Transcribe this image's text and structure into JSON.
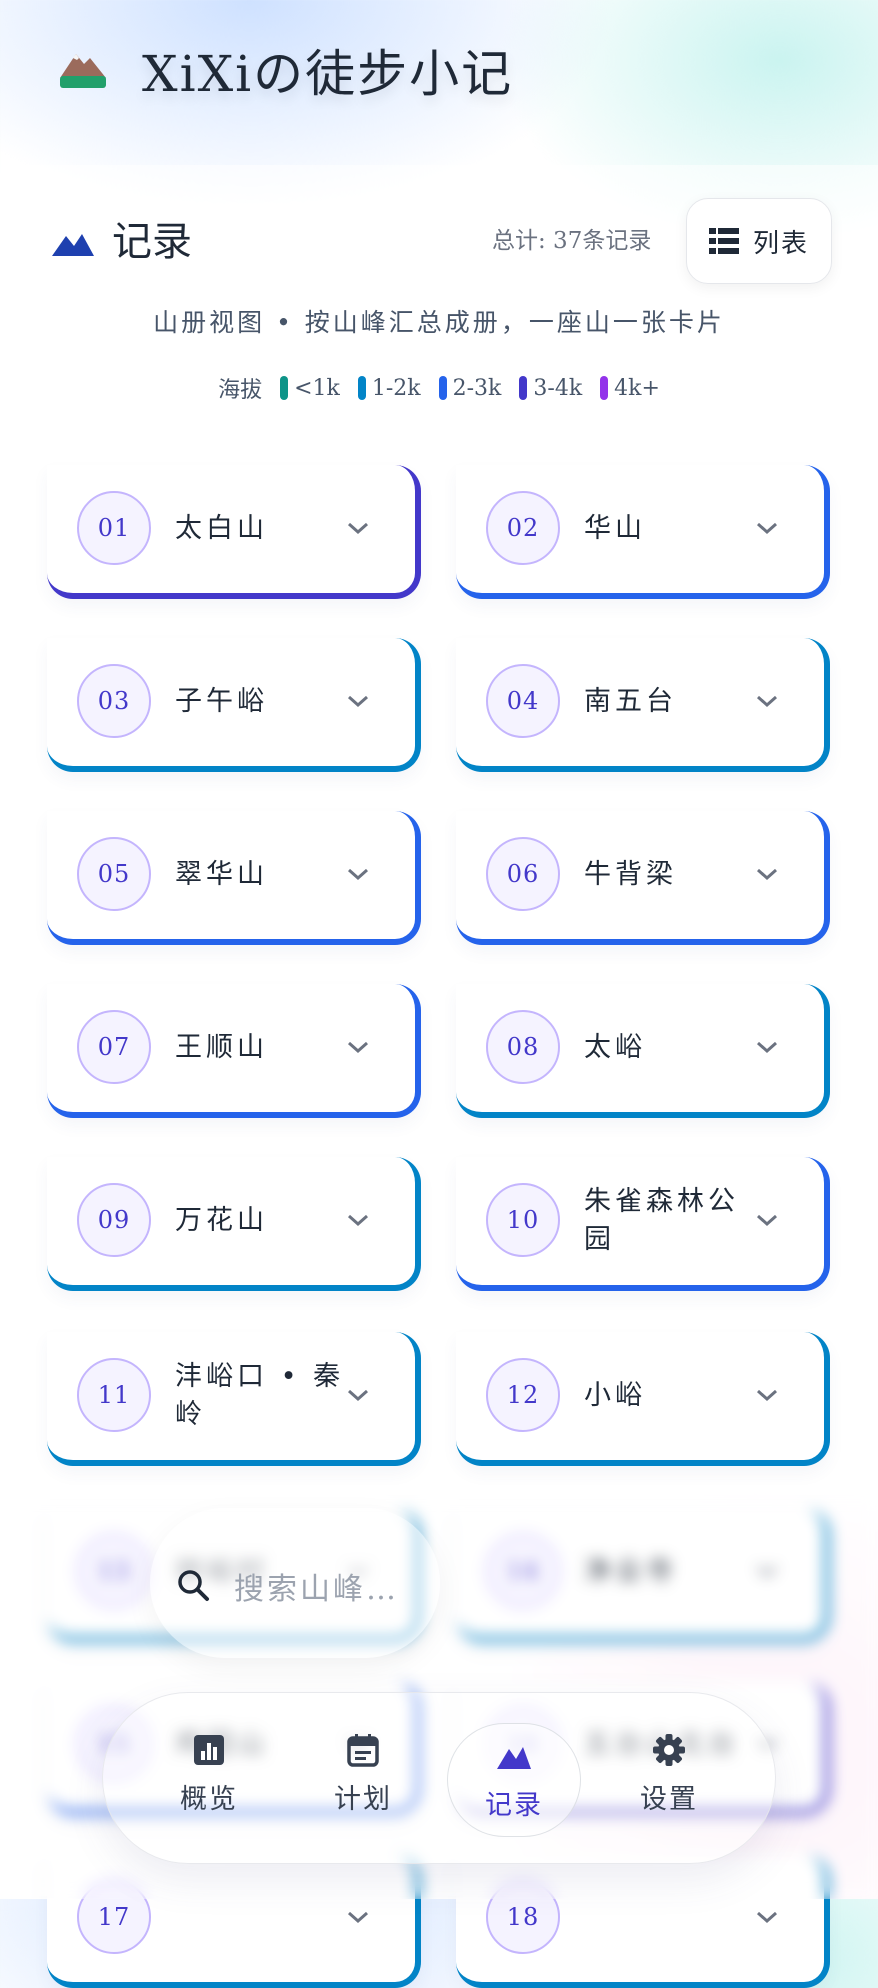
{
  "app": {
    "title": "XiXiの徒步小记"
  },
  "section": {
    "title": "记录",
    "total": "总计: 37条记录",
    "view_toggle_label": "列表",
    "subtitle": "山册视图 • 按山峰汇总成册，一座山一张卡片"
  },
  "legend": {
    "label": "海拔",
    "items": [
      {
        "label": "<1k",
        "color": "#0d9488"
      },
      {
        "label": "1-2k",
        "color": "#0284c7"
      },
      {
        "label": "2-3k",
        "color": "#2563eb"
      },
      {
        "label": "3-4k",
        "color": "#4338ca"
      },
      {
        "label": "4k+",
        "color": "#9333ea"
      }
    ]
  },
  "cards": [
    {
      "num": "01",
      "name": "太白山",
      "color": "#4338ca"
    },
    {
      "num": "02",
      "name": "华山",
      "color": "#2563eb"
    },
    {
      "num": "03",
      "name": "子午峪",
      "color": "#0284c7"
    },
    {
      "num": "04",
      "name": "南五台",
      "color": "#0284c7"
    },
    {
      "num": "05",
      "name": "翠华山",
      "color": "#2563eb"
    },
    {
      "num": "06",
      "name": "牛背梁",
      "color": "#2563eb"
    },
    {
      "num": "07",
      "name": "王顺山",
      "color": "#2563eb"
    },
    {
      "num": "08",
      "name": "太峪",
      "color": "#0284c7"
    },
    {
      "num": "09",
      "name": "万花山",
      "color": "#0284c7"
    },
    {
      "num": "10",
      "name": "朱雀森林公园",
      "color": "#2563eb"
    },
    {
      "num": "11",
      "name": "沣峪口 • 秦岭",
      "color": "#0284c7"
    },
    {
      "num": "12",
      "name": "小峪",
      "color": "#0284c7"
    },
    {
      "num": "13",
      "name": "祥峪村",
      "color": "#0284c7"
    },
    {
      "num": "14",
      "name": "净业寺",
      "color": "#0284c7"
    },
    {
      "num": "15",
      "name": "鸡冠山",
      "color": "#2563eb"
    },
    {
      "num": "16",
      "name": "五台山北台",
      "color": "#4338ca"
    },
    {
      "num": "17",
      "name": "",
      "color": "#0284c7"
    },
    {
      "num": "18",
      "name": "",
      "color": "#0284c7"
    }
  ],
  "search": {
    "placeholder": "搜索山峰…"
  },
  "nav": [
    {
      "label": "概览",
      "icon": "chart-icon",
      "active": false
    },
    {
      "label": "计划",
      "icon": "calendar-icon",
      "active": false
    },
    {
      "label": "记录",
      "icon": "mountain-icon",
      "active": true
    },
    {
      "label": "设置",
      "icon": "gear-icon",
      "active": false
    }
  ],
  "colors": {
    "accent": "#4338ca",
    "primary": "#2563eb",
    "secondary": "#0284c7"
  }
}
